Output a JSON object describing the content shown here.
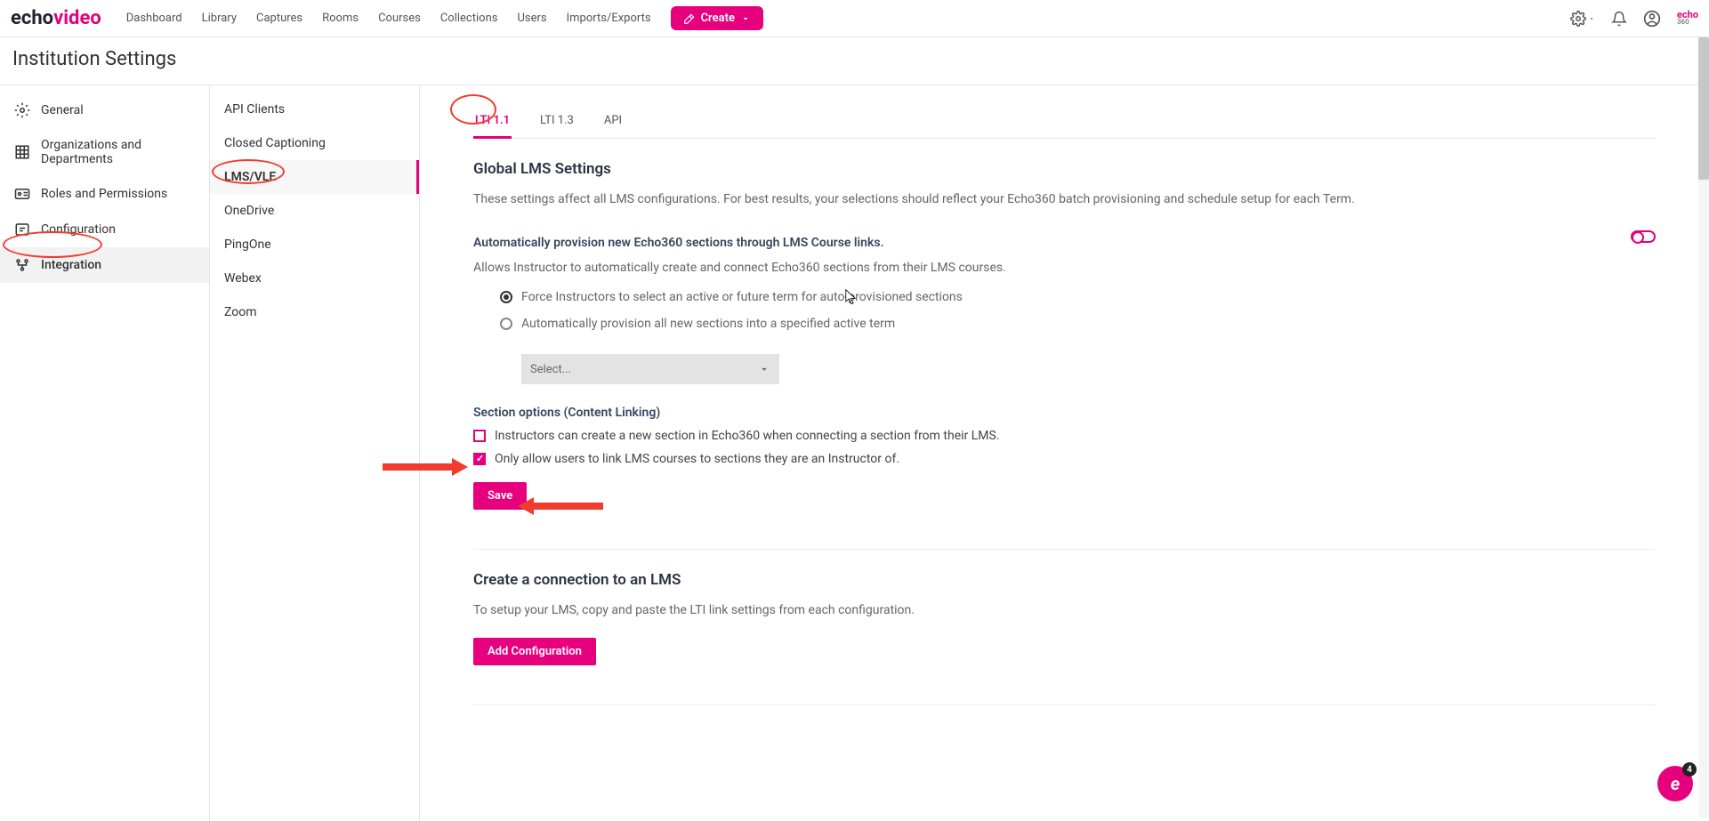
{
  "brand": {
    "prefix": "echo",
    "suffix": "video"
  },
  "nav": {
    "items": [
      "Dashboard",
      "Library",
      "Captures",
      "Rooms",
      "Courses",
      "Collections",
      "Users",
      "Imports/Exports"
    ],
    "create": "Create"
  },
  "page_title": "Institution Settings",
  "left_nav": {
    "items": [
      "General",
      "Organizations and Departments",
      "Roles and Permissions",
      "Configuration",
      "Integration"
    ],
    "active_index": 4
  },
  "sub_nav": {
    "items": [
      "API Clients",
      "Closed Captioning",
      "LMS/VLE",
      "OneDrive",
      "PingOne",
      "Webex",
      "Zoom"
    ],
    "active_index": 2
  },
  "tabs": {
    "items": [
      "LTI 1.1",
      "LTI 1.3",
      "API"
    ],
    "active_index": 0
  },
  "global": {
    "heading": "Global LMS Settings",
    "desc": "These settings affect all LMS configurations. For best results, your selections should reflect your Echo360 batch provisioning and schedule setup for each Term.",
    "auto_head": "Automatically provision new Echo360 sections through LMS Course links.",
    "auto_desc": "Allows Instructor to automatically create and connect Echo360 sections from their LMS courses.",
    "radio_a": "Force Instructors to select an active or future term for auto-provisioned sections",
    "radio_b": "Automatically provision all new sections into a specified active term",
    "select_placeholder": "Select...",
    "section_opts_head": "Section options (Content Linking)",
    "check_a": "Instructors can create a new section in Echo360 when connecting a section from their LMS.",
    "check_b": "Only allow users to link LMS courses to sections they are an Instructor of.",
    "save": "Save"
  },
  "create_conn": {
    "heading": "Create a connection to an LMS",
    "desc": "To setup your LMS, copy and paste the LTI link settings from each configuration.",
    "button": "Add Configuration"
  },
  "help_count": "4",
  "mini_logo": {
    "top": "echo",
    "bottom": "360"
  }
}
